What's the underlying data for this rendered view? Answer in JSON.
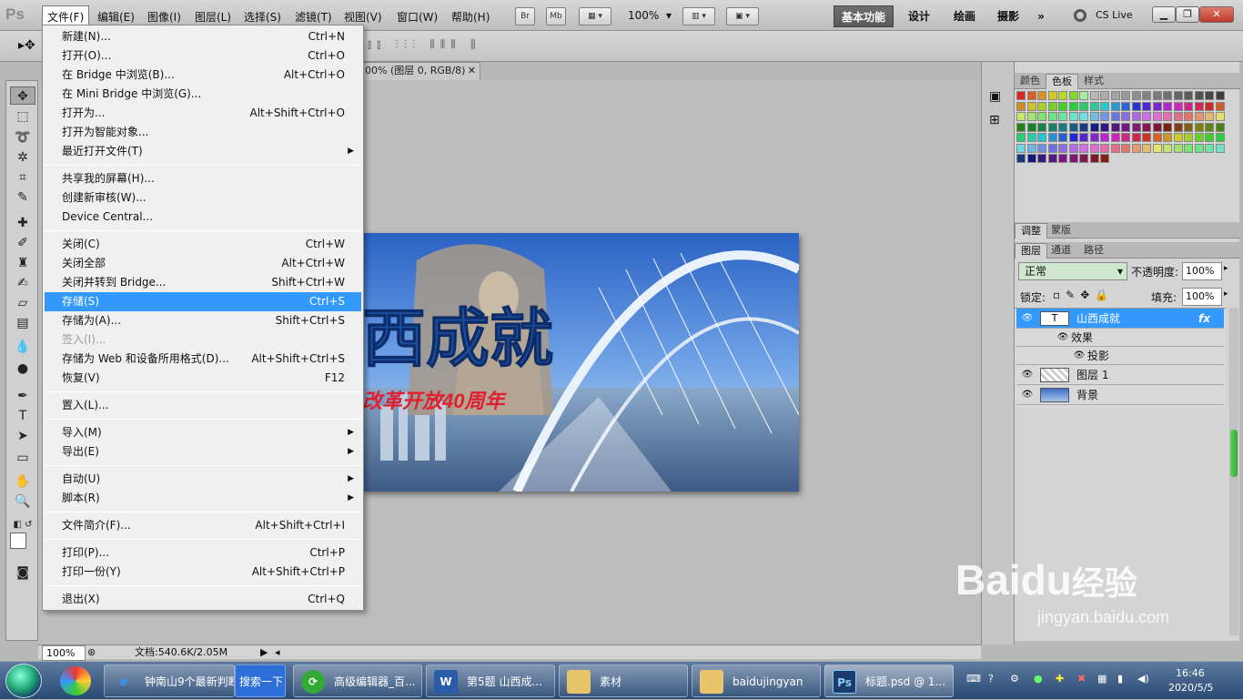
{
  "app": {
    "logo": "Ps"
  },
  "menubar": {
    "items": [
      "文件(F)",
      "编辑(E)",
      "图像(I)",
      "图层(L)",
      "选择(S)",
      "滤镜(T)",
      "视图(V)",
      "窗口(W)",
      "帮助(H)"
    ],
    "br_label": "Br",
    "mb_label": "Mb",
    "zoom": "100%",
    "workspaces": [
      "基本功能",
      "设计",
      "绘画",
      "摄影"
    ],
    "more": "»",
    "cslive": "CS Live"
  },
  "document": {
    "tab_title": "00% (图层 0, RGB/8)",
    "image_text_main": "西成就",
    "image_text_sub": "改革开放40周年"
  },
  "status": {
    "zoom": "100%",
    "doc_info": "文档:540.6K/2.05M"
  },
  "file_menu": {
    "items": [
      {
        "label": "新建(N)...",
        "shortcut": "Ctrl+N"
      },
      {
        "label": "打开(O)...",
        "shortcut": "Ctrl+O"
      },
      {
        "label": "在 Bridge 中浏览(B)...",
        "shortcut": "Alt+Ctrl+O"
      },
      {
        "label": "在 Mini Bridge 中浏览(G)...",
        "shortcut": ""
      },
      {
        "label": "打开为...",
        "shortcut": "Alt+Shift+Ctrl+O"
      },
      {
        "label": "打开为智能对象...",
        "shortcut": ""
      },
      {
        "label": "最近打开文件(T)",
        "shortcut": ""
      },
      {
        "label": "共享我的屏幕(H)...",
        "shortcut": ""
      },
      {
        "label": "创建新审核(W)...",
        "shortcut": ""
      },
      {
        "label": "Device Central...",
        "shortcut": ""
      },
      {
        "label": "关闭(C)",
        "shortcut": "Ctrl+W"
      },
      {
        "label": "关闭全部",
        "shortcut": "Alt+Ctrl+W"
      },
      {
        "label": "关闭并转到 Bridge...",
        "shortcut": "Shift+Ctrl+W"
      },
      {
        "label": "存储(S)",
        "shortcut": "Ctrl+S"
      },
      {
        "label": "存储为(A)...",
        "shortcut": "Shift+Ctrl+S"
      },
      {
        "label": "签入(I)...",
        "shortcut": ""
      },
      {
        "label": "存储为 Web 和设备所用格式(D)...",
        "shortcut": "Alt+Shift+Ctrl+S"
      },
      {
        "label": "恢复(V)",
        "shortcut": "F12"
      },
      {
        "label": "置入(L)...",
        "shortcut": ""
      },
      {
        "label": "导入(M)",
        "shortcut": ""
      },
      {
        "label": "导出(E)",
        "shortcut": ""
      },
      {
        "label": "自动(U)",
        "shortcut": ""
      },
      {
        "label": "脚本(R)",
        "shortcut": ""
      },
      {
        "label": "文件简介(F)...",
        "shortcut": "Alt+Shift+Ctrl+I"
      },
      {
        "label": "打印(P)...",
        "shortcut": "Ctrl+P"
      },
      {
        "label": "打印一份(Y)",
        "shortcut": "Alt+Shift+Ctrl+P"
      },
      {
        "label": "退出(X)",
        "shortcut": "Ctrl+Q"
      }
    ],
    "highlighted": "存储(S)"
  },
  "panels": {
    "color_tabs": [
      "颜色",
      "色板",
      "样式"
    ],
    "adjust_tabs": [
      "调整",
      "蒙版"
    ],
    "layer_tabs": [
      "图层",
      "通道",
      "路径"
    ],
    "blend_mode": "正常",
    "opacity_label": "不透明度:",
    "opacity_value": "100%",
    "lock_label": "锁定:",
    "fill_label": "填充:",
    "fill_value": "100%",
    "layers": [
      {
        "name": "山西成就",
        "fx": "fx"
      },
      {
        "name": "效果"
      },
      {
        "name": "投影"
      },
      {
        "name": "图层 1"
      },
      {
        "name": "背景"
      }
    ]
  },
  "taskbar": {
    "tasks": [
      "钟南山9个最新判断",
      "搜索一下",
      "高级编辑器_百...",
      "第5题 山西成...",
      "素材",
      "baidujingyan",
      "标题.psd @ 1..."
    ],
    "time": "16:46",
    "date": "2020/5/5"
  },
  "watermark": {
    "brand": "Baidu",
    "sub": "经验",
    "url": "jingyan.baidu.com"
  }
}
